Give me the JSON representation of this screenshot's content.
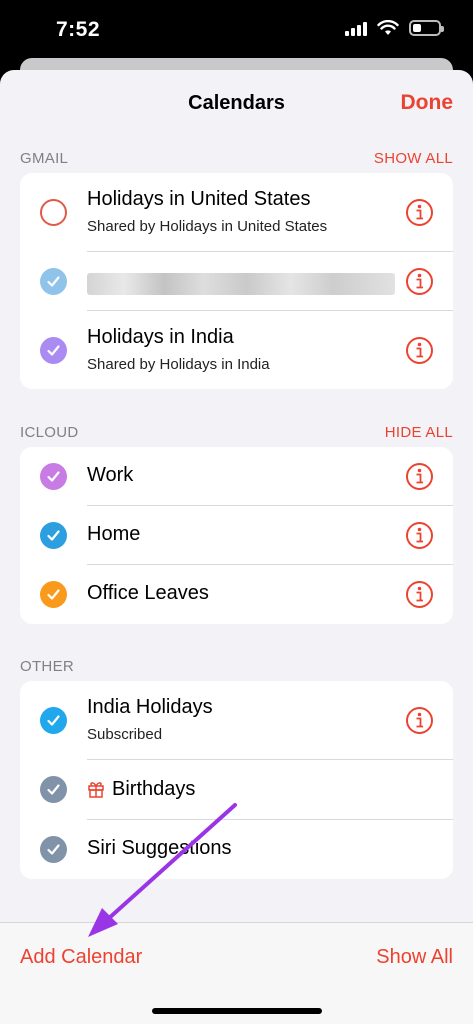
{
  "status": {
    "time": "7:52",
    "battery_level_fraction": 0.35
  },
  "nav": {
    "title": "Calendars",
    "done_label": "Done"
  },
  "sections": {
    "gmail": {
      "label": "GMAIL",
      "action": "SHOW ALL",
      "rows": [
        {
          "title": "Holidays in United States",
          "subtitle": "Shared by Holidays in United States",
          "checked": false
        },
        {
          "title": "",
          "subtitle": "",
          "checked": true,
          "redacted": true
        },
        {
          "title": "Holidays in India",
          "subtitle": "Shared by Holidays in India",
          "checked": true
        }
      ]
    },
    "icloud": {
      "label": "ICLOUD",
      "action": "HIDE ALL",
      "rows": [
        {
          "title": "Work",
          "checked": true
        },
        {
          "title": "Home",
          "checked": true
        },
        {
          "title": "Office Leaves",
          "checked": true
        }
      ]
    },
    "other": {
      "label": "OTHER",
      "rows": [
        {
          "title": "India Holidays",
          "subtitle": "Subscribed",
          "checked": true
        },
        {
          "title": "Birthdays",
          "checked": true
        },
        {
          "title": "Siri Suggestions",
          "checked": true
        }
      ]
    }
  },
  "toolbar": {
    "add_label": "Add Calendar",
    "show_all_label": "Show All"
  },
  "colors": {
    "accent": "#ec4330",
    "holidays_us": "#e05a48",
    "redacted_cal": "#8fc3ea",
    "holidays_india": "#a98bf2",
    "work": "#c77be3",
    "home": "#2d9fe0",
    "office_leaves": "#f99a1d",
    "india_holidays": "#20a7ec",
    "birthdays": "#8193a8",
    "siri_suggestions": "#8193a8",
    "annotation_arrow": "#9a35e6"
  },
  "icons": [
    "checkmark-icon",
    "info-icon",
    "gift-icon",
    "wifi-icon",
    "signal-icon",
    "battery-icon"
  ]
}
